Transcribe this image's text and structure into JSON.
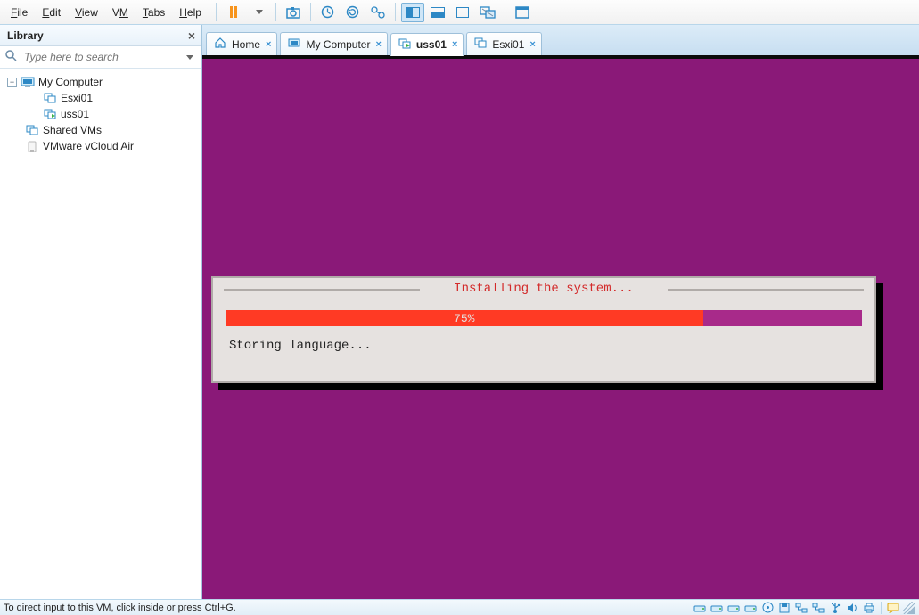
{
  "menubar": {
    "file": "File",
    "edit": "Edit",
    "view": "View",
    "vm": "VM",
    "tabs": "Tabs",
    "help": "Help"
  },
  "library": {
    "title": "Library",
    "search_placeholder": "Type here to search"
  },
  "tree": {
    "root": "My Computer",
    "vm1": "Esxi01",
    "vm2": "uss01",
    "shared": "Shared VMs",
    "vcloud": "VMware vCloud Air"
  },
  "tabs": {
    "home": "Home",
    "mycomputer": "My Computer",
    "uss": "uss01",
    "esxi": "Esxi01"
  },
  "installer": {
    "title": "Installing the system...",
    "percent_text": "75%",
    "percent": 75,
    "status": "Storing language..."
  },
  "statusbar": {
    "msg": "To direct input to this VM, click inside or press Ctrl+G."
  }
}
